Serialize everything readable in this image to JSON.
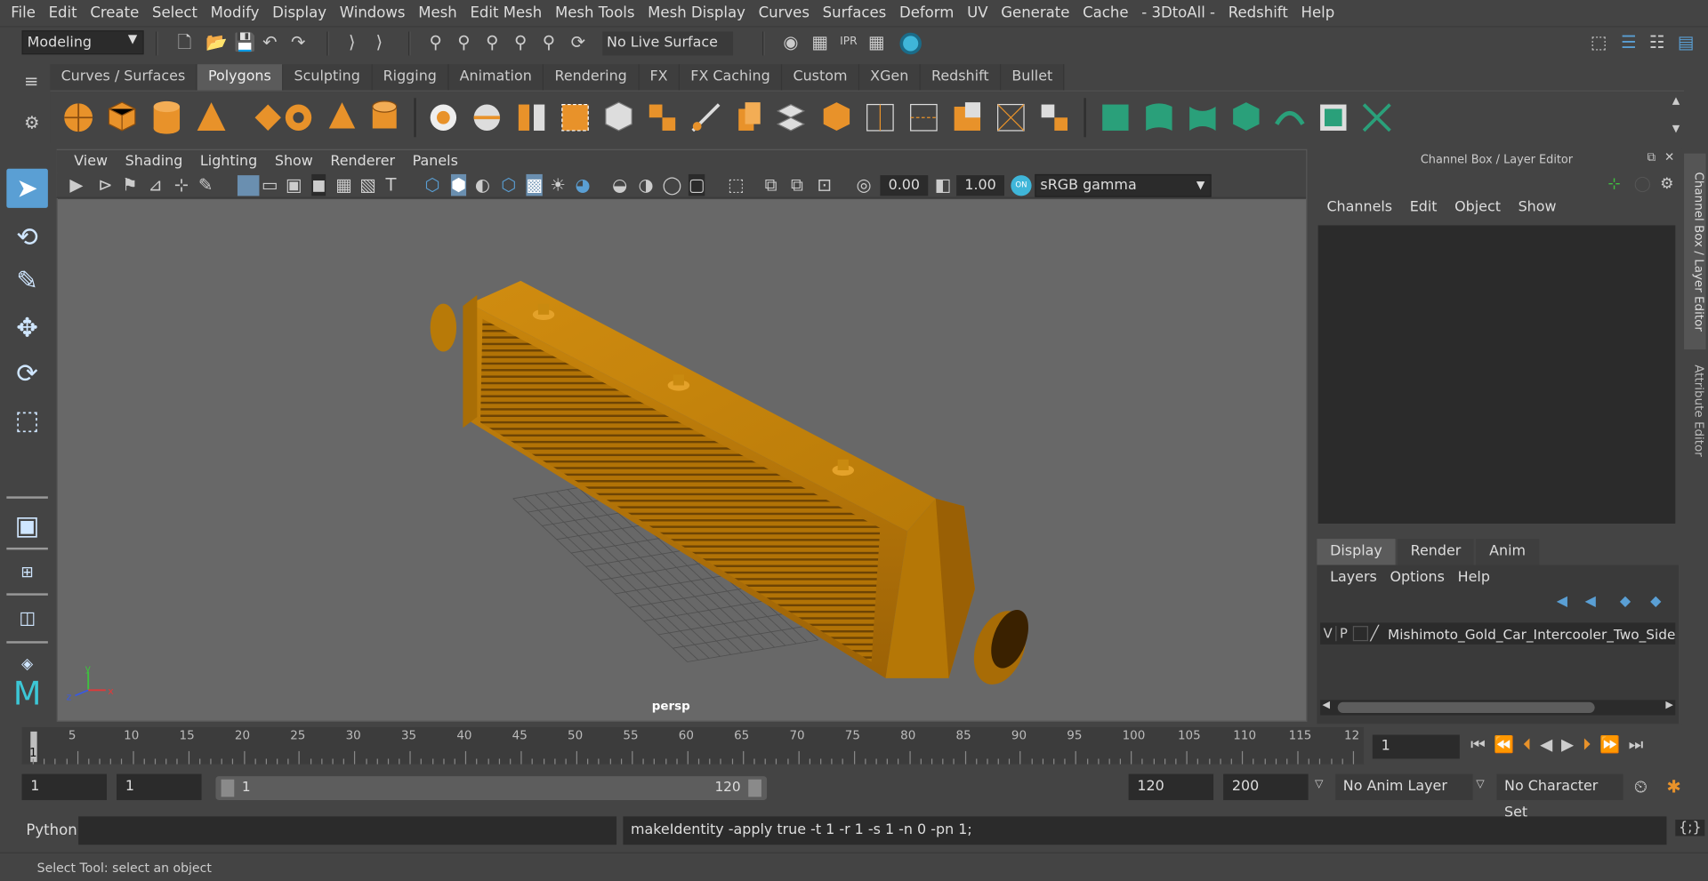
{
  "menubar": {
    "items": [
      "File",
      "Edit",
      "Create",
      "Select",
      "Modify",
      "Display",
      "Windows",
      "Mesh",
      "Edit Mesh",
      "Mesh Tools",
      "Mesh Display",
      "Curves",
      "Surfaces",
      "Deform",
      "UV",
      "Generate",
      "Cache",
      "- 3DtoAll -",
      "Redshift",
      "Help"
    ]
  },
  "status": {
    "mode": "Modeling",
    "live_surface": "No Live Surface"
  },
  "shelf": {
    "tabs": [
      "Curves / Surfaces",
      "Polygons",
      "Sculpting",
      "Rigging",
      "Animation",
      "Rendering",
      "FX",
      "FX Caching",
      "Custom",
      "XGen",
      "Redshift",
      "Bullet"
    ],
    "active": "Polygons"
  },
  "viewport": {
    "menu": [
      "View",
      "Shading",
      "Lighting",
      "Show",
      "Renderer",
      "Panels"
    ],
    "exposure": "0.00",
    "gamma": "1.00",
    "colorspace": "sRGB gamma",
    "camera": "persp",
    "axis_x": "x",
    "axis_y": "y",
    "axis_z": "z"
  },
  "channelbox": {
    "title": "Channel Box / Layer Editor",
    "menu": [
      "Channels",
      "Edit",
      "Object",
      "Show"
    ],
    "tabs": [
      "Display",
      "Render",
      "Anim"
    ],
    "layer_menu": [
      "Layers",
      "Options",
      "Help"
    ],
    "layer": {
      "v": "V",
      "p": "P",
      "name": "Mishimoto_Gold_Car_Intercooler_Two_Side"
    },
    "side_tabs": [
      "Channel Box / Layer Editor",
      "Attribute Editor"
    ]
  },
  "timeline": {
    "ticks": [
      "5",
      "10",
      "15",
      "20",
      "25",
      "30",
      "35",
      "40",
      "45",
      "50",
      "55",
      "60",
      "65",
      "70",
      "75",
      "80",
      "85",
      "90",
      "95",
      "100",
      "105",
      "110",
      "115",
      "12"
    ],
    "current_marker": "1",
    "current_frame": "1"
  },
  "range": {
    "start": "1",
    "current": "1",
    "slider_start": "1",
    "slider_end": "120",
    "end": "120",
    "max": "200",
    "anim_layer": "No Anim Layer",
    "char_set": "No Character Set"
  },
  "command": {
    "language": "Python",
    "text": "makeIdentity -apply true -t 1 -r 1 -s 1 -n 0 -pn 1;"
  },
  "helpline": "Select Tool: select an object",
  "colors": {
    "accent": "#5a9fd4",
    "gold": "#c8860a",
    "shelf_orange": "#e8922a",
    "shelf_green": "#2aa07a"
  }
}
